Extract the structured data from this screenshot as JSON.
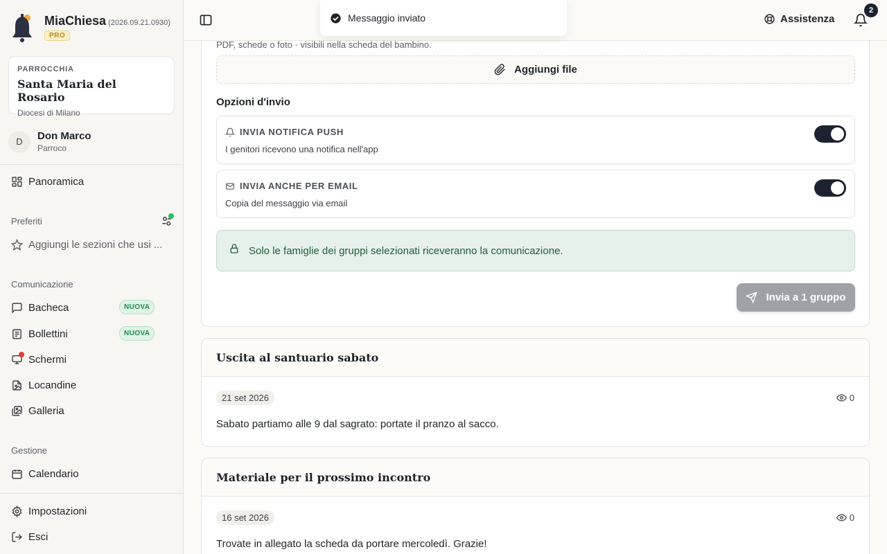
{
  "brand": {
    "name": "MiaChiesa",
    "version": "(2026.09.21.0930)",
    "plan": "PRO"
  },
  "parish": {
    "label": "PARROCCHIA",
    "name": "Santa Maria del Rosario",
    "diocese": "Diocesi di Milano"
  },
  "user": {
    "initial": "D",
    "name": "Don Marco",
    "role": "Parroco"
  },
  "nav": {
    "overview": "Panoramica",
    "favorites_label": "Preferiti",
    "favorites_hint": "Aggiungi le sezioni che usi ...",
    "communication_label": "Comunicazione",
    "communication_items": [
      {
        "label": "Bacheca",
        "badge": "NUOVA"
      },
      {
        "label": "Bollettini",
        "badge": "NUOVA"
      },
      {
        "label": "Schermi"
      },
      {
        "label": "Locandine"
      },
      {
        "label": "Galleria"
      }
    ],
    "management_label": "Gestione",
    "calendar": "Calendario",
    "settings": "Impostazioni",
    "logout": "Esci"
  },
  "topbar": {
    "help": "Assistenza",
    "notifications_count": "2"
  },
  "toast": {
    "message": "Messaggio inviato"
  },
  "compose": {
    "attachments_hint": "PDF, schede o foto · visibili nella scheda del bambino.",
    "add_file": "Aggiungi file",
    "options_title": "Opzioni d'invio",
    "push": {
      "title": "INVIA NOTIFICA PUSH",
      "desc": "I genitori ricevono una notifica nell'app",
      "enabled": true
    },
    "email": {
      "title": "INVIA ANCHE PER EMAIL",
      "desc": "Copia del messaggio via email",
      "enabled": true
    },
    "notice": "Solo le famiglie dei gruppi selezionati riceveranno la comunicazione.",
    "send": "Invia a 1 gruppo"
  },
  "posts": [
    {
      "title": "Uscita al santuario sabato",
      "date": "21 set 2026",
      "views": "0",
      "text": "Sabato partiamo alle 9 dal sagrato: portate il pranzo al sacco."
    },
    {
      "title": "Materiale per il prossimo incontro",
      "date": "16 set 2026",
      "views": "0",
      "text": "Trovate in allegato la scheda da portare mercoledì. Grazie!"
    }
  ],
  "colors": {
    "accent": "#1c2230",
    "success": "#1f8a4c",
    "logo": "#2b3140",
    "logo_dot": "#f2a93b",
    "alert_dot": "#e5383b"
  }
}
